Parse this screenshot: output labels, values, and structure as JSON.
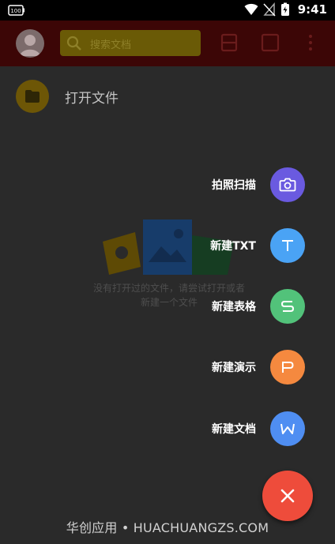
{
  "status_bar": {
    "battery_left": "100",
    "time": "9:41",
    "icons": [
      "wifi-icon",
      "signal-off-icon",
      "battery-charging-icon"
    ]
  },
  "app_bar": {
    "search_placeholder": "搜索文档",
    "icons": [
      "avatar",
      "search-icon",
      "layout-icon",
      "square-icon",
      "more-vert-icon"
    ]
  },
  "list": {
    "open_file_label": "打开文件"
  },
  "empty_state": {
    "line1": "没有打开过的文件，请尝试打开或者",
    "line2": "新建一个文件"
  },
  "fab_menu": {
    "items": [
      {
        "label": "拍照扫描",
        "icon": "camera-icon",
        "color": "#6a5ae0"
      },
      {
        "label": "新建TXT",
        "icon": "txt-t-icon",
        "color": "#4aa3f5"
      },
      {
        "label": "新建表格",
        "icon": "sheet-s-icon",
        "color": "#52c27a"
      },
      {
        "label": "新建演示",
        "icon": "slides-p-icon",
        "color": "#f5893f"
      },
      {
        "label": "新建文档",
        "icon": "doc-w-icon",
        "color": "#4f8ef2"
      }
    ],
    "main_icon": "close-icon",
    "main_color": "#ee4c3b"
  },
  "watermark": "华创应用 • HUACHUANGZS.COM"
}
